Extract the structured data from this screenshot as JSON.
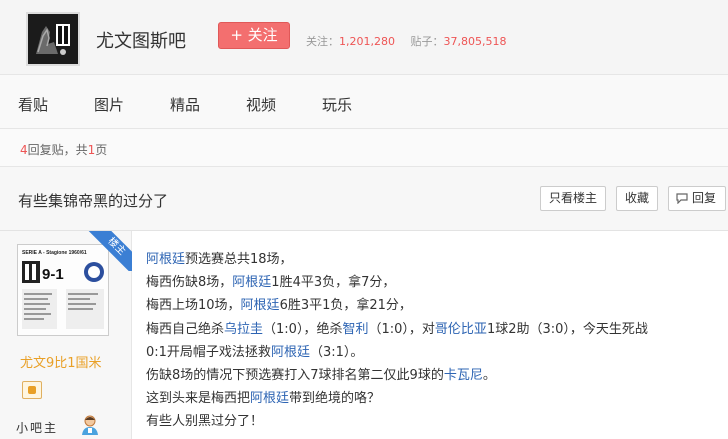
{
  "forum": {
    "name": "尤文图斯吧",
    "follow_label": "+ 关注",
    "follow_count_label": "关注：",
    "follow_count": "1,201,280",
    "post_count_label": "贴子：",
    "post_count": "37,805,518"
  },
  "nav": {
    "tabs": [
      {
        "label": "看贴"
      },
      {
        "label": "图片"
      },
      {
        "label": "精品"
      },
      {
        "label": "视频"
      },
      {
        "label": "玩乐"
      }
    ]
  },
  "thread": {
    "reply_count": "4",
    "reply_label": "回复贴，共",
    "page_count": "1",
    "page_suffix": "页",
    "title": "有些集锦帝黑的过分了",
    "only_op_label": "只看楼主",
    "favorite_label": "收藏",
    "reply_button_label": "回复"
  },
  "post": {
    "op_badge": "楼主",
    "avatar_caption": "SERIE A - Stagione 1960/61",
    "avatar_score": "9-1",
    "username": "尤文9比1国米",
    "role": "小吧主",
    "lines": [
      [
        {
          "t": "阿根廷",
          "link": true
        },
        {
          "t": "预选赛总共18场，",
          "link": false
        }
      ],
      [
        {
          "t": "梅西伤缺8场，",
          "link": false
        },
        {
          "t": "阿根廷",
          "link": true
        },
        {
          "t": "1胜4平3负，拿7分，",
          "link": false
        }
      ],
      [
        {
          "t": "梅西上场10场，",
          "link": false
        },
        {
          "t": "阿根廷",
          "link": true
        },
        {
          "t": "6胜3平1负，拿21分，",
          "link": false
        }
      ],
      [
        {
          "t": "梅西自己绝杀",
          "link": false
        },
        {
          "t": "乌拉圭",
          "link": true
        },
        {
          "t": "（1:0），绝杀",
          "link": false
        },
        {
          "t": "智利",
          "link": true
        },
        {
          "t": "（1:0），对",
          "link": false
        },
        {
          "t": "哥伦比亚",
          "link": true
        },
        {
          "t": "1球2助（3:0），今天生死战",
          "link": false
        }
      ],
      [
        {
          "t": "0:1开局帽子戏法拯救",
          "link": false
        },
        {
          "t": "阿根廷",
          "link": true
        },
        {
          "t": "（3:1）。",
          "link": false
        }
      ],
      [
        {
          "t": "伤缺8场的情况下预选赛打入7球排名第二仅此9球的",
          "link": false
        },
        {
          "t": "卡瓦尼",
          "link": true
        },
        {
          "t": "。",
          "link": false
        }
      ],
      [
        {
          "t": "这到头来是梅西把",
          "link": false
        },
        {
          "t": "阿根廷",
          "link": true
        },
        {
          "t": "带到绝境的咯？",
          "link": false
        }
      ],
      [
        {
          "t": "有些人别黑过分了！",
          "link": false
        }
      ]
    ]
  },
  "colors": {
    "accent_red": "#f36f6f",
    "link_blue": "#2d64b3",
    "username_orange": "#e9a027",
    "op_badge_blue": "#3b7fd4"
  }
}
